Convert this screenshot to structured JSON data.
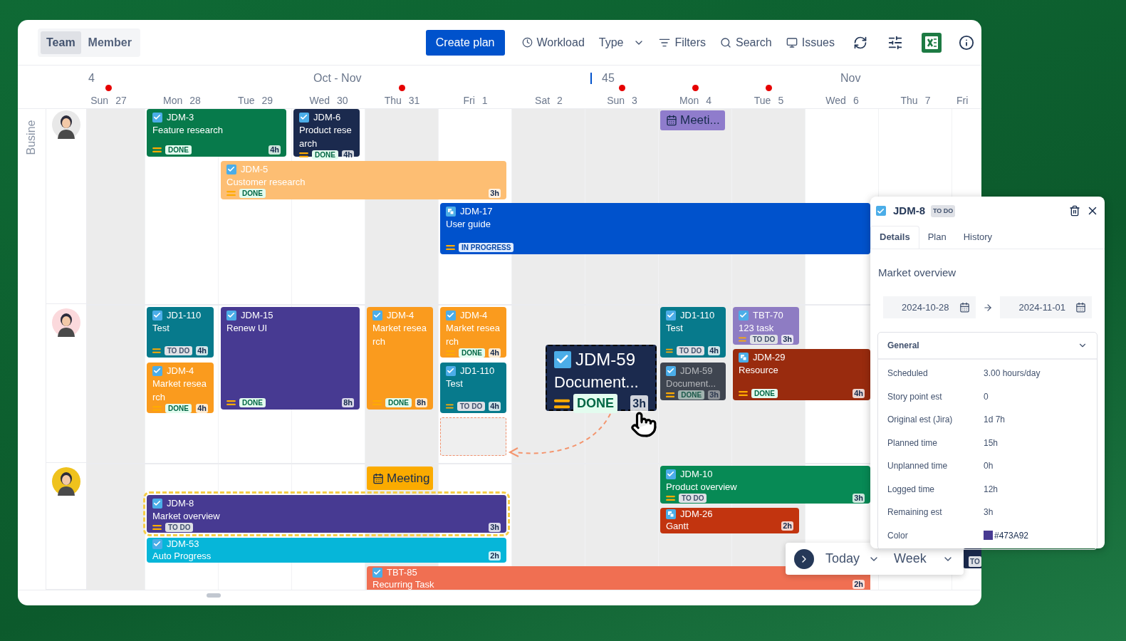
{
  "view_switch": [
    {
      "label": "Team",
      "selected": true
    },
    {
      "label": "Member",
      "selected": false
    }
  ],
  "create_button": "Create plan",
  "toolbar": [
    {
      "kind": "clock",
      "label": "Workload"
    },
    {
      "kind": "dropdown",
      "label": "Type"
    },
    {
      "kind": "filter",
      "label": "Filters"
    },
    {
      "kind": "search",
      "label": "Search"
    },
    {
      "kind": "issues",
      "label": "Issues"
    }
  ],
  "week_labels": [
    {
      "kind": "week",
      "text": "4"
    },
    {
      "kind": "month",
      "text": "Oct - Nov"
    },
    {
      "kind": "current-week",
      "text": "45"
    },
    {
      "kind": "month",
      "text": "Nov"
    }
  ],
  "days": [
    {
      "weekday": "Sun",
      "day": "27",
      "off": true,
      "holiday": true
    },
    {
      "weekday": "Mon",
      "day": "28",
      "off": false,
      "holiday": false
    },
    {
      "weekday": "Tue",
      "day": "29",
      "off": false,
      "holiday": false
    },
    {
      "weekday": "Wed",
      "day": "30",
      "off": false,
      "holiday": false
    },
    {
      "weekday": "Thu",
      "day": "31",
      "off": true,
      "holiday": true
    },
    {
      "weekday": "Fri",
      "day": "1",
      "off": false,
      "holiday": false
    },
    {
      "weekday": "Sat",
      "day": "2",
      "off": true,
      "holiday": false
    },
    {
      "weekday": "Sun",
      "day": "3",
      "off": true,
      "holiday": true
    },
    {
      "weekday": "Mon",
      "day": "4",
      "off": true,
      "holiday": true
    },
    {
      "weekday": "Tue",
      "day": "5",
      "off": true,
      "holiday": true
    },
    {
      "weekday": "Wed",
      "day": "6",
      "off": false,
      "holiday": false
    },
    {
      "weekday": "Thu",
      "day": "7",
      "off": false,
      "holiday": false
    },
    {
      "weekday": "Fri",
      "off": false,
      "holiday": false
    }
  ],
  "group_label": "Busine",
  "members": [
    {
      "color": "#e8e8e8"
    },
    {
      "color": "#fbd9dc"
    },
    {
      "color": "#efc21d"
    }
  ],
  "cards": [
    {
      "kind": "task",
      "key": "JDM-3",
      "title": "Feature research",
      "status": {
        "kind": "done",
        "label": "DONE"
      },
      "hours": "4h",
      "color": "#077a4b",
      "selected": false
    },
    {
      "kind": "task",
      "key": "JDM-6",
      "title": "Product research",
      "status": {
        "kind": "done",
        "label": "DONE"
      },
      "hours": "4h",
      "color": "#1b2a4e",
      "selected": false
    },
    {
      "kind": "task",
      "key": "JDM-5",
      "title": "Customer research",
      "status": {
        "kind": "done",
        "label": "DONE"
      },
      "hours": "3h",
      "color": "#fdbe73",
      "selected": false
    },
    {
      "kind": "subtask",
      "key": "JDM-17",
      "title": "User guide",
      "status": {
        "kind": "in_progress",
        "label": "IN PROGRESS"
      },
      "color": "#0052cc",
      "selected": false
    },
    {
      "kind": "meeting",
      "title": "Meeti...",
      "color": "#8f7ccc",
      "selected": false
    },
    {
      "kind": "task",
      "key": "JD1-110",
      "title": "Test",
      "status": {
        "kind": "todo",
        "label": "TO DO"
      },
      "hours": "4h",
      "color": "#077a8c",
      "selected": false
    },
    {
      "kind": "task",
      "key": "JDM-4",
      "title": "Market research",
      "status": {
        "kind": "done",
        "label": "DONE"
      },
      "hours": "4h",
      "color": "#fa9b1e",
      "selected": false
    },
    {
      "kind": "task",
      "key": "JDM-15",
      "title": "Renew UI",
      "status": {
        "kind": "done",
        "label": "DONE"
      },
      "hours": "8h",
      "color": "#473a92",
      "selected": false
    },
    {
      "kind": "task",
      "key": "JDM-4",
      "title": "Market research",
      "status": {
        "kind": "done",
        "label": "DONE"
      },
      "hours": "8h",
      "color": "#fa9b1e",
      "selected": false
    },
    {
      "kind": "task",
      "key": "JDM-4",
      "title": "Market research",
      "status": {
        "kind": "done",
        "label": "DONE"
      },
      "hours": "4h",
      "color": "#fa9b1e",
      "selected": false
    },
    {
      "kind": "task",
      "key": "JD1-110",
      "title": "Test",
      "status": {
        "kind": "todo",
        "label": "TO DO"
      },
      "hours": "4h",
      "color": "#077a8c",
      "selected": false
    },
    {
      "kind": "dragged-task",
      "key": "JDM-59",
      "title": "Document...",
      "status": {
        "kind": "done",
        "label": "DONE"
      },
      "hours": "3h",
      "color": "#1b2a4e",
      "selected": false
    },
    {
      "kind": "task",
      "key": "JD1-110",
      "title": "Test",
      "status": {
        "kind": "todo",
        "label": "TO DO"
      },
      "hours": "4h",
      "color": "#077a8c",
      "selected": false
    },
    {
      "kind": "task",
      "key": "TBT-70",
      "title": "123 task",
      "status": {
        "kind": "todo",
        "label": "TO DO"
      },
      "hours": "3h",
      "color": "#8e7cc3",
      "selected": false
    },
    {
      "kind": "ghost-task",
      "key": "JDM-59",
      "title": "Document...",
      "status": {
        "kind": "done",
        "label": "DONE"
      },
      "hours": "3h",
      "color": "#3f4550",
      "selected": false
    },
    {
      "kind": "subtask",
      "key": "JDM-29",
      "title": "Resource",
      "status": {
        "kind": "done",
        "label": "DONE"
      },
      "hours": "4h",
      "color": "#992b0e",
      "selected": false
    },
    {
      "kind": "meeting",
      "title": "Meeting",
      "color": "#fbab00",
      "selected": false
    },
    {
      "kind": "task",
      "key": "JDM-8",
      "title": "Market overview",
      "status": {
        "kind": "todo",
        "label": "TO DO"
      },
      "hours": "3h",
      "color": "#473a92",
      "selected": true
    },
    {
      "kind": "task",
      "key": "JDM-53",
      "title": "Auto Progress",
      "hours": "2h",
      "color": "#06b6d9",
      "selected": false
    },
    {
      "kind": "task",
      "key": "JDM-10",
      "title": "Product overview",
      "status": {
        "kind": "todo",
        "label": "TO DO"
      },
      "hours": "3h",
      "color": "#078a55",
      "selected": false
    },
    {
      "kind": "subtask",
      "key": "JDM-26",
      "title": "Gantt",
      "hours": "2h",
      "color": "#c2340f",
      "selected": false
    },
    {
      "kind": "fragment",
      "status": {
        "kind": "todo",
        "label": "TO"
      },
      "color": "#1b2a4e",
      "selected": false
    },
    {
      "kind": "task",
      "key": "TBT-85",
      "title": "Recurring Task",
      "hours": "2h",
      "color": "#f06f52",
      "selected": false
    }
  ],
  "nav": {
    "today": "Today",
    "range": "Week"
  },
  "panel": {
    "key": "JDM-8",
    "status": "TO DO",
    "tabs": [
      {
        "label": "Details",
        "selected": true
      },
      {
        "label": "Plan",
        "selected": false
      },
      {
        "label": "History",
        "selected": false
      }
    ],
    "title": "Market overview",
    "start": "2024-10-28",
    "end": "2024-11-01",
    "section": {
      "title": "General",
      "expanded": true,
      "fields": [
        {
          "kind": "text",
          "label": "Scheduled",
          "value": "3.00 hours/day"
        },
        {
          "kind": "text",
          "label": "Story point est",
          "value": "0"
        },
        {
          "kind": "text",
          "label": "Original est (Jira)",
          "value": "1d 7h"
        },
        {
          "kind": "text",
          "label": "Planned time",
          "value": "15h"
        },
        {
          "kind": "text",
          "label": "Unplanned time",
          "value": "0h"
        },
        {
          "kind": "text",
          "label": "Logged time",
          "value": "12h"
        },
        {
          "kind": "text",
          "label": "Remaining est",
          "value": "3h"
        },
        {
          "kind": "color",
          "label": "Color",
          "value": "#473A92",
          "color": "#473a92"
        }
      ]
    }
  }
}
